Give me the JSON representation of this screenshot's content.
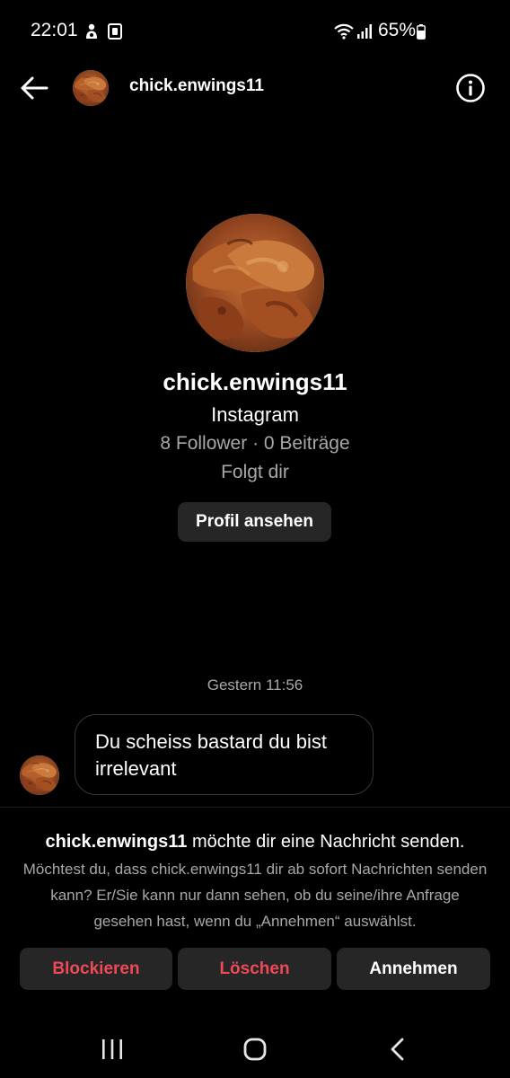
{
  "status_bar": {
    "time": "22:01",
    "battery": "65%",
    "icons": [
      "person-badge-icon",
      "square-app-icon",
      "wifi-icon",
      "signal-icon",
      "battery-icon"
    ]
  },
  "header": {
    "username": "chick.enwings11",
    "icons": [
      "back-arrow-icon",
      "info-icon"
    ]
  },
  "profile": {
    "username": "chick.enwings11",
    "platform": "Instagram",
    "stats": "8 Follower · 0 Beiträge",
    "follows_you": "Folgt dir",
    "view_profile_label": "Profil ansehen"
  },
  "messages": {
    "timestamp": "Gestern 11:56",
    "items": [
      {
        "text": "Du scheiss bastard du bist irrelevant"
      }
    ]
  },
  "request": {
    "username": "chick.enwings11",
    "title_suffix": " möchte dir eine Nachricht senden.",
    "description": "Möchtest du, dass chick.enwings11 dir ab sofort Nachrichten senden kann? Er/Sie kann nur dann sehen, ob du seine/ihre Anfrage gesehen hast, wenn du „Annehmen“ auswählst.",
    "block_label": "Blockieren",
    "delete_label": "Löschen",
    "accept_label": "Annehmen"
  },
  "colors": {
    "background": "#000000",
    "button_bg": "#262626",
    "danger": "#ed4956",
    "secondary_text": "#a8a8a8"
  }
}
